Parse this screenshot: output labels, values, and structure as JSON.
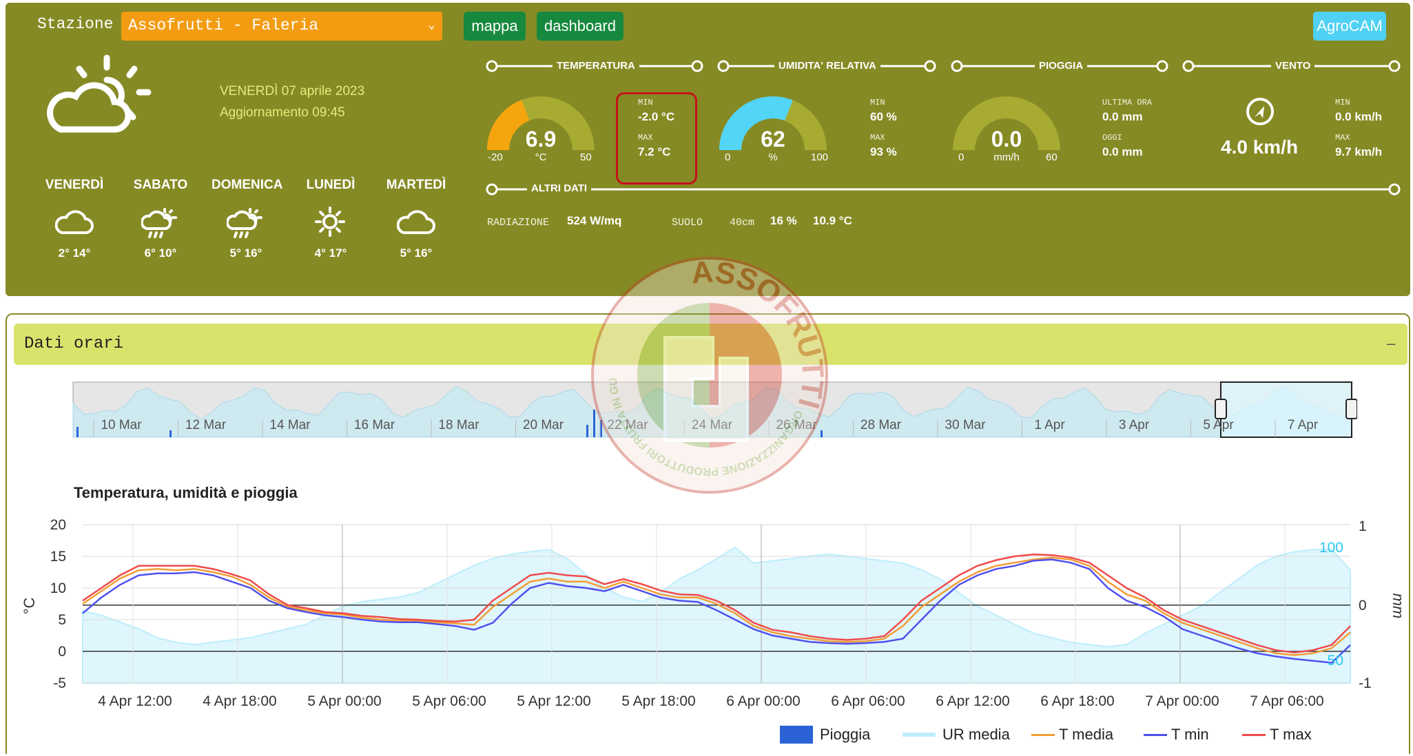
{
  "station": {
    "label": "Stazione",
    "selected": "Assofrutti - Faleria"
  },
  "buttons": {
    "mappa": "mappa",
    "dashboard": "dashboard",
    "agrocam": "AgroCAM"
  },
  "current": {
    "icon": "partly-cloudy-icon",
    "date": "VENERDÌ 07 aprile 2023",
    "update": "Aggiornamento 09:45"
  },
  "forecast": [
    {
      "day": "VENERDÌ",
      "icon": "cloud-icon",
      "temps": "2° 14°"
    },
    {
      "day": "SABATO",
      "icon": "sun-rain-cloud-icon",
      "temps": "6° 10°"
    },
    {
      "day": "DOMENICA",
      "icon": "sun-rain-cloud-icon",
      "temps": "5° 16°"
    },
    {
      "day": "LUNEDÌ",
      "icon": "sun-icon",
      "temps": "4° 17°"
    },
    {
      "day": "MARTEDÌ",
      "icon": "cloud-icon",
      "temps": "5° 16°"
    }
  ],
  "temperature": {
    "title": "TEMPERATURA",
    "value": "6.9",
    "unit": "°C",
    "min_scale": "-20",
    "max_scale": "50",
    "min_label": "MIN",
    "min_value": "-2.0 °C",
    "max_label": "MAX",
    "max_value": "7.2 °C",
    "fill_fraction": 0.384,
    "color": "#f5a50d"
  },
  "humidity": {
    "title": "UMIDITA' RELATIVA",
    "value": "62",
    "unit": "%",
    "min_scale": "0",
    "max_scale": "100",
    "min_label": "MIN",
    "min_value": "60 %",
    "max_label": "MAX",
    "max_value": "93 %",
    "fill_fraction": 0.62,
    "color": "#52d5f6"
  },
  "rain": {
    "title": "PIOGGIA",
    "value": "0.0",
    "unit": "mm/h",
    "min_scale": "0",
    "max_scale": "60",
    "last_hour_label": "ULTIMA ORA",
    "last_hour_value": "0.0 mm",
    "today_label": "OGGI",
    "today_value": "0.0 mm",
    "fill_fraction": 0.0
  },
  "wind": {
    "title": "VENTO",
    "icon": "wind-direction-icon",
    "value": "4.0 km/h",
    "min_label": "MIN",
    "min_value": "0.0 km/h",
    "max_label": "MAX",
    "max_value": "9.7 km/h"
  },
  "other": {
    "title": "ALTRI DATI",
    "radiation_label": "RADIAZIONE",
    "radiation_value": "524 W/mq",
    "soil_label": "SUOLO",
    "soil_depth": "40cm",
    "soil_humidity": "16 %",
    "soil_temp": "10.9 °C"
  },
  "watermark": {
    "text": "ASSOFRUTTI",
    "subtext": "ORGANIZZAZIONE PRODUTTORI FRUTTA IN GUSCIO"
  },
  "panel": {
    "title": "Dati orari",
    "collapse": "–"
  },
  "navigator": {
    "labels": [
      "10 Mar",
      "12 Mar",
      "14 Mar",
      "16 Mar",
      "18 Mar",
      "20 Mar",
      "22 Mar",
      "24 Mar",
      "26 Mar",
      "28 Mar",
      "30 Mar",
      "1 Apr",
      "3 Apr",
      "5 Apr",
      "7 Apr"
    ]
  },
  "chart_data": {
    "type": "line",
    "title": "Temperatura, umidità e pioggia",
    "x": [
      "4 Apr 12:00",
      "4 Apr 18:00",
      "5 Apr 00:00",
      "5 Apr 06:00",
      "5 Apr 12:00",
      "5 Apr 18:00",
      "6 Apr 00:00",
      "6 Apr 06:00",
      "6 Apr 12:00",
      "6 Apr 18:00",
      "7 Apr 00:00",
      "7 Apr 06:00"
    ],
    "y_left": {
      "label": "°C",
      "ticks": [
        "20",
        "15",
        "10",
        "5",
        "0",
        "-5"
      ],
      "range": [
        -5,
        20
      ]
    },
    "y_right_rain": {
      "label": "mm",
      "ticks": [
        "1",
        "0",
        "-1"
      ],
      "range": [
        -1,
        1
      ]
    },
    "y_right_humidity": {
      "ticks": [
        "100",
        "50"
      ]
    },
    "series": [
      {
        "name": "Pioggia",
        "color": "#2b63d6",
        "values": [
          0,
          0,
          0,
          0,
          0,
          0,
          0,
          0,
          0,
          0,
          0,
          0,
          0,
          0,
          0,
          0,
          0,
          0,
          0,
          0,
          0,
          0,
          0,
          0,
          0,
          0,
          0,
          0,
          0,
          0,
          0,
          0,
          0,
          0,
          0,
          0,
          0,
          0,
          0,
          0,
          0,
          0,
          0,
          0,
          0,
          0,
          0,
          0,
          0,
          0,
          0,
          0,
          0,
          0,
          0,
          0,
          0,
          0,
          0,
          0,
          0,
          0,
          0,
          0,
          0,
          0,
          0,
          0,
          0
        ]
      },
      {
        "name": "UR media",
        "color": "#bfeefa",
        "values": [
          72,
          70,
          67,
          64,
          60,
          58,
          57,
          58,
          59,
          60,
          62,
          64,
          66,
          70,
          74,
          76,
          77,
          78,
          80,
          84,
          88,
          92,
          95,
          97,
          98,
          99,
          95,
          88,
          82,
          78,
          76,
          80,
          86,
          90,
          95,
          100,
          93,
          94,
          95,
          96,
          97,
          96,
          95,
          94,
          93,
          90,
          86,
          80,
          74,
          70,
          66,
          62,
          60,
          58,
          57,
          56,
          57,
          62,
          66,
          70,
          74,
          80,
          86,
          92,
          96,
          98,
          99,
          99,
          90
        ]
      },
      {
        "name": "T media",
        "color": "#f39c34",
        "values": [
          7.5,
          9.5,
          11.5,
          12.8,
          13,
          12.8,
          13,
          12.5,
          11.8,
          10.5,
          8.5,
          7,
          6.5,
          6,
          5.8,
          5.3,
          5,
          4.8,
          4.8,
          4.6,
          4.4,
          4.2,
          7,
          9,
          11,
          11.5,
          11,
          11,
          10,
          11,
          10,
          9,
          8.5,
          8.5,
          7.5,
          6,
          4,
          3,
          2.4,
          2,
          1.6,
          1.5,
          1.6,
          2,
          4,
          7,
          9,
          11,
          12.5,
          13.5,
          14,
          14.5,
          14.8,
          14.5,
          13.5,
          11,
          9,
          8,
          6,
          4.5,
          3.5,
          2.5,
          1.5,
          0.5,
          -0.3,
          -0.6,
          -0.3,
          0.5,
          3
        ]
      },
      {
        "name": "T min",
        "color": "#5050ee",
        "values": [
          6,
          8.5,
          10.5,
          12,
          12.3,
          12.3,
          12.5,
          12,
          11,
          10,
          8,
          6.8,
          6.2,
          5.7,
          5.4,
          5,
          4.7,
          4.6,
          4.6,
          4.3,
          4,
          3.4,
          4.5,
          7.5,
          10,
          10.8,
          10.3,
          10,
          9.5,
          10.5,
          9.5,
          8.5,
          8,
          7.8,
          6.5,
          5,
          3.5,
          2.5,
          2,
          1.5,
          1.3,
          1.2,
          1.3,
          1.5,
          2,
          5,
          8,
          10.5,
          12,
          13,
          13.5,
          14.3,
          14.5,
          14,
          13,
          10,
          8,
          7,
          5.5,
          3.5,
          2.5,
          1.5,
          0.5,
          -0.3,
          -0.8,
          -1.2,
          -1.5,
          -1.8,
          1
        ]
      },
      {
        "name": "T max",
        "color": "#f04a4a",
        "values": [
          8,
          10,
          12,
          13.5,
          13.5,
          13.5,
          13.5,
          13,
          12.2,
          11.2,
          9,
          7.3,
          6.8,
          6.2,
          6,
          5.6,
          5.4,
          5.1,
          5,
          4.8,
          4.7,
          5,
          8,
          10,
          12,
          12.4,
          12,
          11.8,
          10.6,
          11.4,
          10.6,
          9.6,
          9,
          8.9,
          8,
          6.5,
          4.5,
          3.4,
          3,
          2.4,
          2,
          1.8,
          2,
          2.4,
          5,
          8,
          10,
          12,
          13.5,
          14.4,
          15,
          15.3,
          15.2,
          14.8,
          14,
          12,
          10,
          8.5,
          6.5,
          5,
          4,
          3,
          2,
          1,
          0.2,
          -0.2,
          0.2,
          1,
          4
        ]
      }
    ],
    "legend": [
      "Pioggia",
      "UR media",
      "T media",
      "T min",
      "T max"
    ]
  }
}
